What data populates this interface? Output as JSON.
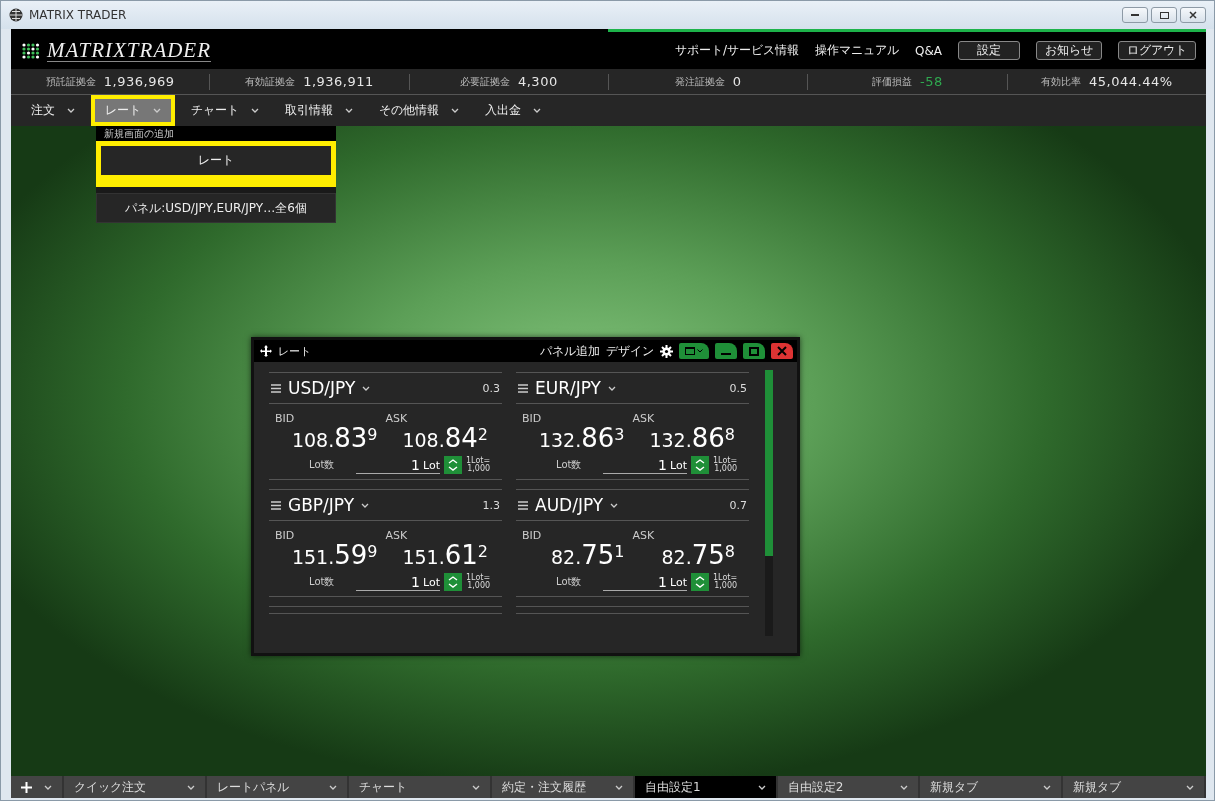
{
  "window": {
    "title": "MATRIX TRADER"
  },
  "header": {
    "logo": "MATRIXTRADER",
    "links": [
      "サポート/サービス情報",
      "操作マニュアル",
      "Q&A"
    ],
    "buttons": [
      "設定",
      "お知らせ",
      "ログアウト"
    ]
  },
  "account": [
    {
      "label": "預託証拠金",
      "value": "1,936,969",
      "color": "#e6e6e6"
    },
    {
      "label": "有効証拠金",
      "value": "1,936,911",
      "color": "#e6e6e6"
    },
    {
      "label": "必要証拠金",
      "value": "4,300",
      "color": "#e6e6e6"
    },
    {
      "label": "発注証拠金",
      "value": "0",
      "color": "#e6e6e6"
    },
    {
      "label": "評価損益",
      "value": "-58",
      "color": "#2fa84f"
    },
    {
      "label": "有効比率",
      "value": "45,044.44%",
      "color": "#e6e6e6"
    }
  ],
  "menu": [
    {
      "label": "注文",
      "selected": false,
      "highlight": false
    },
    {
      "label": "レート",
      "selected": true,
      "highlight": true
    },
    {
      "label": "チャート",
      "selected": false,
      "highlight": false
    },
    {
      "label": "取引情報",
      "selected": false,
      "highlight": false
    },
    {
      "label": "その他情報",
      "selected": false,
      "highlight": false
    },
    {
      "label": "入出金",
      "selected": false,
      "highlight": false
    }
  ],
  "dropdown": {
    "heading": "新規画面の追加",
    "items": [
      {
        "label": "レート",
        "highlight": true
      },
      {
        "label": "パネル:USD/JPY,EUR/JPY…全6個",
        "highlight": false
      }
    ]
  },
  "panel": {
    "title": "レート",
    "actions": [
      "パネル追加",
      "デザイン"
    ],
    "pairs": [
      {
        "name": "USD/JPY",
        "spread": "0.3",
        "bid_label": "BID",
        "ask_label": "ASK",
        "bid": [
          "108.",
          "83",
          "9"
        ],
        "ask": [
          "108.",
          "84",
          "2"
        ],
        "lot_label": "Lot数",
        "lot_value": "1",
        "lot_unit": "Lot",
        "lot_note": [
          "1Lot=",
          "1,000"
        ]
      },
      {
        "name": "EUR/JPY",
        "spread": "0.5",
        "bid_label": "BID",
        "ask_label": "ASK",
        "bid": [
          "132.",
          "86",
          "3"
        ],
        "ask": [
          "132.",
          "86",
          "8"
        ],
        "lot_label": "Lot数",
        "lot_value": "1",
        "lot_unit": "Lot",
        "lot_note": [
          "1Lot=",
          "1,000"
        ]
      },
      {
        "name": "GBP/JPY",
        "spread": "1.3",
        "bid_label": "BID",
        "ask_label": "ASK",
        "bid": [
          "151.",
          "59",
          "9"
        ],
        "ask": [
          "151.",
          "61",
          "2"
        ],
        "lot_label": "Lot数",
        "lot_value": "1",
        "lot_unit": "Lot",
        "lot_note": [
          "1Lot=",
          "1,000"
        ]
      },
      {
        "name": "AUD/JPY",
        "spread": "0.7",
        "bid_label": "BID",
        "ask_label": "ASK",
        "bid": [
          "82.",
          "75",
          "1"
        ],
        "ask": [
          "82.",
          "75",
          "8"
        ],
        "lot_label": "Lot数",
        "lot_value": "1",
        "lot_unit": "Lot",
        "lot_note": [
          "1Lot=",
          "1,000"
        ]
      }
    ]
  },
  "bottom_tabs": [
    {
      "label": "クイック注文",
      "selected": false
    },
    {
      "label": "レートパネル",
      "selected": false
    },
    {
      "label": "チャート",
      "selected": false
    },
    {
      "label": "約定・注文履歴",
      "selected": false
    },
    {
      "label": "自由設定1",
      "selected": true
    },
    {
      "label": "自由設定2",
      "selected": false
    },
    {
      "label": "新規タブ",
      "selected": false
    },
    {
      "label": "新規タブ",
      "selected": false
    }
  ]
}
